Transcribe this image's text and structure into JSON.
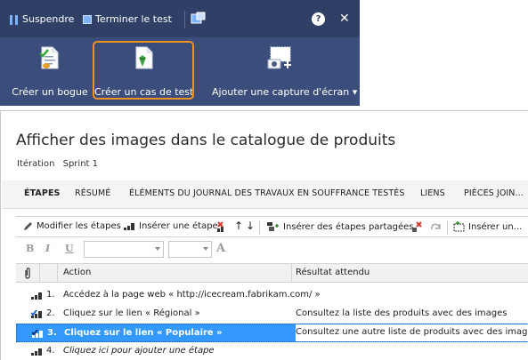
{
  "runner": {
    "pause_label": "Suspendre",
    "end_test_label": "Terminer le test",
    "help_label": "?",
    "close_label": "✕",
    "buttons": [
      {
        "label": "Créer un bogue",
        "icon": "bug-document-icon"
      },
      {
        "label": "Créer un cas de test",
        "icon": "test-case-document-icon"
      },
      {
        "label": "Ajouter une capture d'écran",
        "icon": "camera-screenshot-icon"
      }
    ],
    "accent_color": "#f0921e",
    "panel_color": "#3b4d7a"
  },
  "work_item": {
    "title": "Afficher des images dans le catalogue de produits",
    "iteration_label": "Itération",
    "iteration_value": "Sprint 1",
    "tabs": [
      "ÉTAPES",
      "RÉSUMÉ",
      "ÉLÉMENTS DU JOURNAL DES TRAVAUX EN SOUFFRANCE TESTÉS",
      "LIENS",
      "PIÈCES JOIN..."
    ],
    "active_tab": "ÉTAPES"
  },
  "steps_toolbar": {
    "edit_steps": "Modifier les étapes",
    "insert_step": "Insérer une étape",
    "insert_shared": "Insérer des étapes partagées",
    "insert_more": "Insérer un..."
  },
  "format_toolbar": {
    "bold": "B",
    "italic": "I",
    "underline": "U",
    "font_color": "A"
  },
  "grid": {
    "col_action": "Action",
    "col_expected": "Résultat attendu",
    "rows": [
      {
        "num": "1.",
        "action": "Accédez à la page web « http://icecream.fabrikam.com/ »",
        "expected": ""
      },
      {
        "num": "2.",
        "action": "Cliquez sur le lien « Régional »",
        "expected": "Consultez la liste des produits avec des images"
      },
      {
        "num": "3.",
        "action": "Cliquez sur le lien « Populaire »",
        "expected": "Consultez une autre liste de produits avec des images"
      },
      {
        "num": "4.",
        "action": "Cliquez ici pour ajouter une étape",
        "expected": ""
      }
    ],
    "selected_color": "#3399ff"
  }
}
